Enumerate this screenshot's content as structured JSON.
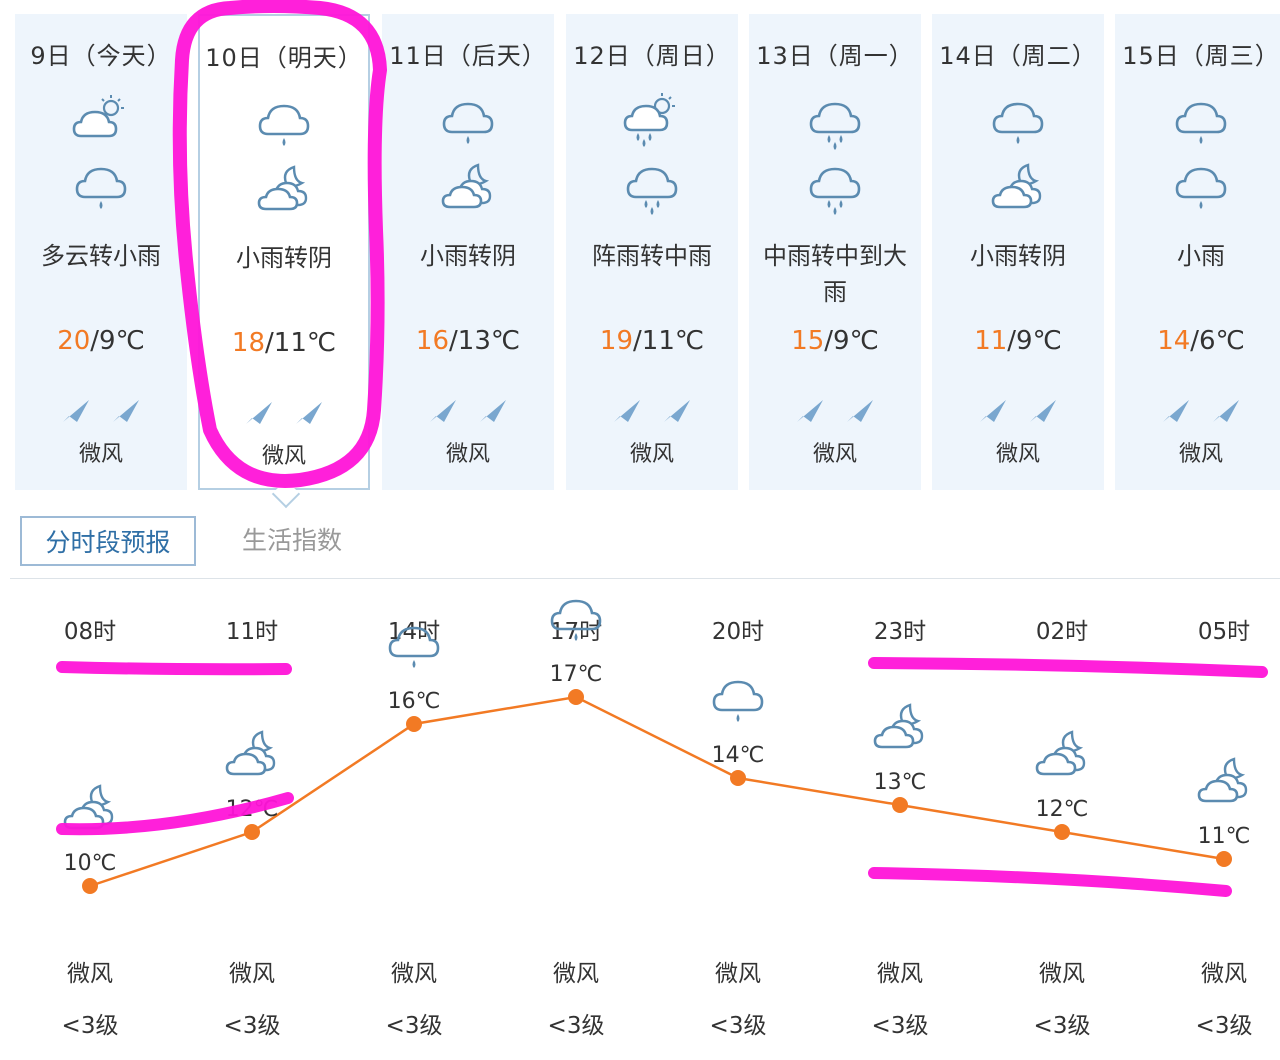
{
  "colors": {
    "accent": "#f27a24",
    "icon": "#5b8bb0",
    "highlight": "#ff14d8",
    "tab": "#2f6fa6"
  },
  "days": [
    {
      "date": "9日（今天）",
      "icon_day": "partly-cloudy-sun-icon",
      "icon_night": "rain-icon",
      "desc": "多云转小雨",
      "high": "20",
      "low": "9",
      "unit": "℃",
      "wind": "微风",
      "selected": false
    },
    {
      "date": "10日（明天）",
      "icon_day": "rain-icon",
      "icon_night": "cloudy-night-icon",
      "desc": "小雨转阴",
      "high": "18",
      "low": "11",
      "unit": "℃",
      "wind": "微风",
      "selected": true
    },
    {
      "date": "11日（后天）",
      "icon_day": "rain-icon",
      "icon_night": "cloudy-night-icon",
      "desc": "小雨转阴",
      "high": "16",
      "low": "13",
      "unit": "℃",
      "wind": "微风",
      "selected": false
    },
    {
      "date": "12日（周日）",
      "icon_day": "shower-sun-icon",
      "icon_night": "moderate-rain-icon",
      "desc": "阵雨转中雨",
      "high": "19",
      "low": "11",
      "unit": "℃",
      "wind": "微风",
      "selected": false
    },
    {
      "date": "13日（周一）",
      "icon_day": "moderate-rain-icon",
      "icon_night": "moderate-rain-icon",
      "desc": "中雨转中到大雨",
      "high": "15",
      "low": "9",
      "unit": "℃",
      "wind": "微风",
      "selected": false
    },
    {
      "date": "14日（周二）",
      "icon_day": "rain-icon",
      "icon_night": "cloudy-night-icon",
      "desc": "小雨转阴",
      "high": "11",
      "low": "9",
      "unit": "℃",
      "wind": "微风",
      "selected": false
    },
    {
      "date": "15日（周三）",
      "icon_day": "rain-icon",
      "icon_night": "rain-icon",
      "desc": "小雨",
      "high": "14",
      "low": "6",
      "unit": "℃",
      "wind": "微风",
      "selected": false
    }
  ],
  "tabs": {
    "hourly": "分时段预报",
    "life": "生活指数"
  },
  "hourly": {
    "times": [
      "08时",
      "11时",
      "14时",
      "17时",
      "20时",
      "23时",
      "02时",
      "05时"
    ],
    "icons": [
      "cloudy-night-icon",
      "cloudy-night-icon",
      "rain-icon",
      "rain-icon",
      "rain-icon",
      "cloudy-night-icon",
      "cloudy-night-icon",
      "cloudy-night-icon"
    ],
    "winds": [
      "微风",
      "微风",
      "微风",
      "微风",
      "微风",
      "微风",
      "微风",
      "微风"
    ],
    "levels": [
      "<3级",
      "<3级",
      "<3级",
      "<3级",
      "<3级",
      "<3级",
      "<3级",
      "<3级"
    ]
  },
  "chart_data": {
    "type": "line",
    "x": [
      "08时",
      "11时",
      "14时",
      "17时",
      "20时",
      "23时",
      "02时",
      "05时"
    ],
    "series": [
      {
        "values": [
          10,
          12,
          16,
          17,
          14,
          13,
          12,
          11
        ]
      }
    ],
    "value_labels": [
      "10℃",
      "12℃",
      "16℃",
      "17℃",
      "14℃",
      "13℃",
      "12℃",
      "11℃"
    ]
  }
}
